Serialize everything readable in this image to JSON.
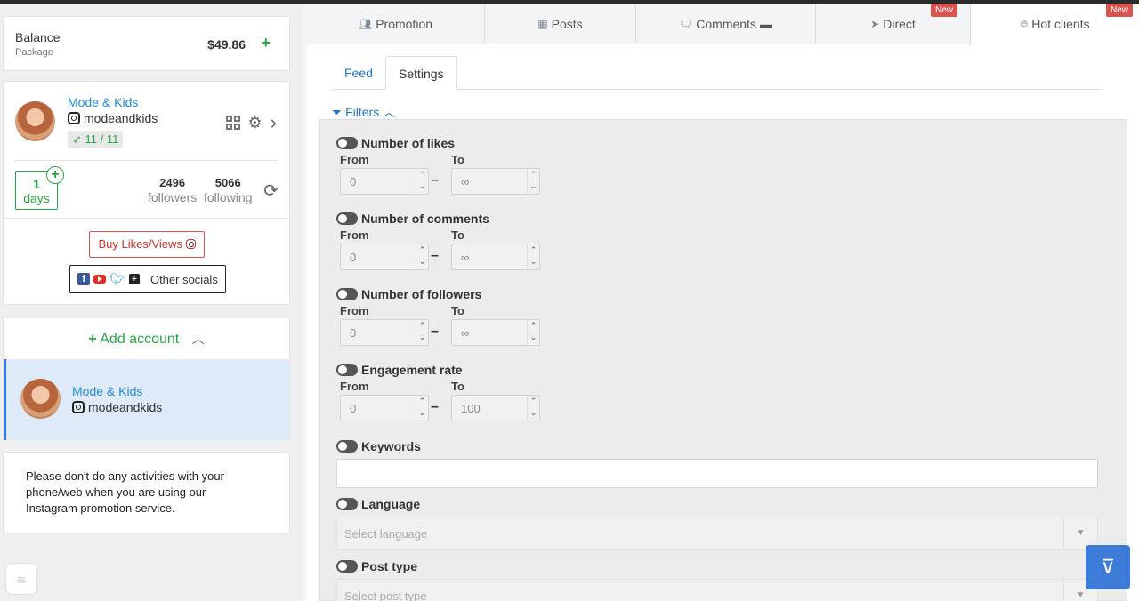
{
  "balance": {
    "label": "Balance",
    "sub": "Package",
    "amount": "$49.86",
    "plus": "+"
  },
  "account": {
    "name": "Mode & Kids",
    "username": "modeandkids",
    "badge": "11 / 11",
    "days_value": "1",
    "days_label": "days",
    "followers_value": "2496",
    "followers_label": "followers",
    "following_value": "5066",
    "following_label": "following",
    "buy_label": "Buy Likes/Views",
    "other_socials_label": "Other socials"
  },
  "add_account": {
    "label": "Add account"
  },
  "active_account": {
    "name": "Mode & Kids",
    "username": "modeandkids"
  },
  "notice": "Please don't do any activities with your phone/web when you are using our Instagram promotion service.",
  "tabs": [
    {
      "label": "Promotion",
      "icon": "users-icon"
    },
    {
      "label": "Posts",
      "icon": "grid-icon"
    },
    {
      "label": "Comments",
      "icon": "comments-icon"
    },
    {
      "label": "Direct",
      "icon": "send-icon",
      "badge": "New"
    },
    {
      "label": "Hot clients",
      "icon": "fire-icon",
      "badge": "New"
    }
  ],
  "subtabs": [
    {
      "label": "Feed"
    },
    {
      "label": "Settings"
    }
  ],
  "filters": {
    "link": "Filters",
    "from_label": "From",
    "to_label": "To",
    "ranges": [
      {
        "title": "Number of likes",
        "from": "0",
        "to": "∞"
      },
      {
        "title": "Number of comments",
        "from": "0",
        "to": "∞"
      },
      {
        "title": "Number of followers",
        "from": "0",
        "to": "∞"
      },
      {
        "title": "Engagement rate",
        "from": "0",
        "to": "100"
      }
    ],
    "keywords": {
      "title": "Keywords",
      "value": ""
    },
    "language": {
      "title": "Language",
      "placeholder": "Select language"
    },
    "post_type": {
      "title": "Post type",
      "placeholder": "Select post type"
    }
  },
  "colors": {
    "accent": "#27a744",
    "link": "#1f8fd1",
    "badge_new": "#d9534f",
    "float_button": "#3d7bd9"
  }
}
